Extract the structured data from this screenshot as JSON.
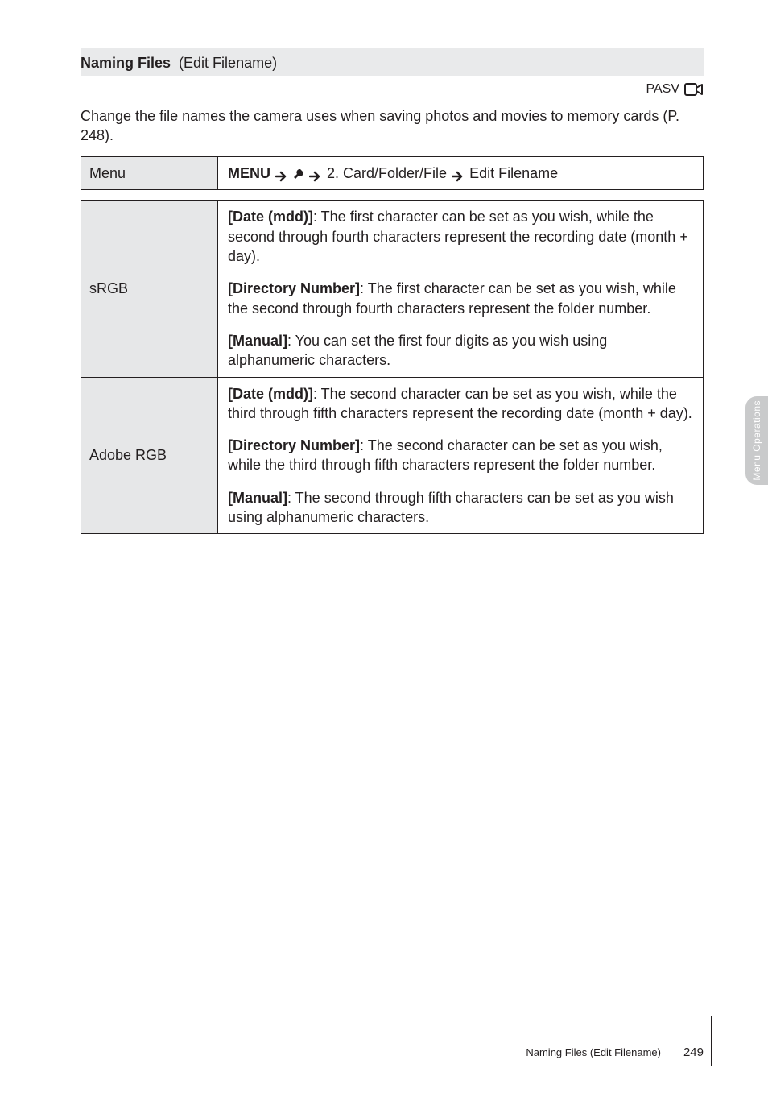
{
  "topbar": {
    "key": "Naming Files",
    "value": "(Edit Filename)"
  },
  "pasv": {
    "label": "PASV"
  },
  "intro": {
    "pre": "Change the file names the camera uses when saving photos and movies to memory cards (",
    "link_text": "P. 248",
    "post": ")."
  },
  "menu_row": {
    "label": "Menu",
    "seg1": "MENU",
    "seg2": "",
    "seg3": "2. Card/Folder/File",
    "seg4": "Edit Filename"
  },
  "srgb": {
    "label": "sRGB",
    "opt1": {
      "title": "[Date (mdd)]",
      "desc": ": The first character can be set as you wish, while the second through fourth characters represent the recording date (month + day)."
    },
    "opt2": {
      "title": "[Directory Number]",
      "desc": ": The first character can be set as you wish, while the second through fourth characters represent the folder number."
    },
    "opt3": {
      "title_strong": "[Manual]",
      "title_tail": ": You can set the first four digits as you wish using alphanumeric characters.",
      "desc": ""
    }
  },
  "adobe": {
    "label": "Adobe RGB",
    "opt1": {
      "title": "[Date (mdd)]",
      "desc": ": The second character can be set as you wish, while the third through fifth characters represent the recording date (month + day)."
    },
    "opt2": {
      "title": "[Directory Number]",
      "desc": ": The second character can be set as you wish, while the third through fifth characters represent the folder number."
    },
    "opt3": {
      "title": "[Manual]",
      "desc": ": The second through fifth characters can be set as you wish using alphanumeric characters."
    }
  },
  "side_tab": "Menu Operations",
  "footer": {
    "title": "Naming Files (Edit Filename)",
    "page": "249"
  }
}
